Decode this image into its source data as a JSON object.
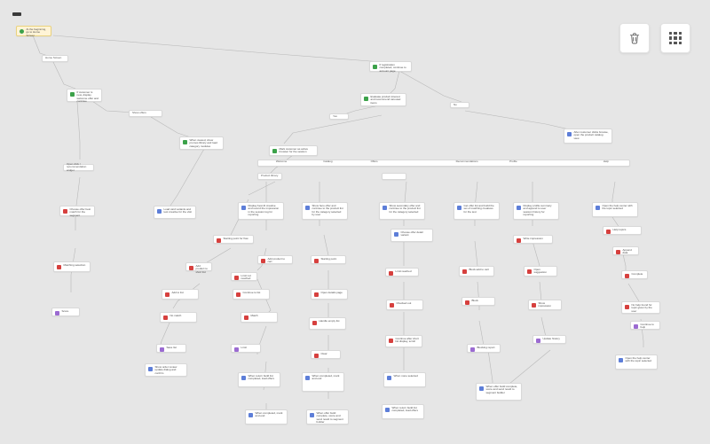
{
  "toolbar": {
    "delete_tooltip": "Delete",
    "grid_tooltip": "Switch layout"
  },
  "nodes": {
    "start": "At the beginning, go to Home Screen",
    "n1": "Home Screen",
    "n2": "If customer is new, display welcome offer and continue",
    "n3": "Show offers",
    "n4": "If registration completed, continue to account page",
    "n5": "Evaluate product interest and recommend carousel items",
    "n6": "Yes",
    "n7": "No",
    "n8": "When viewed, show promos library and load category modules",
    "n9": "After customer clicks browse, open the product catalog view",
    "n10": "Mark customer as active browser for the session",
    "n11": "Open click / recommendation widget",
    "n12": "Product library",
    "n13": "",
    "c0": "Welcome",
    "c1": "Catalog",
    "c2": "Offers",
    "c3": "",
    "c4": "Recommendations",
    "c5": "Profile",
    "c6": "",
    "c7": "Help",
    "n14": "Choose offer best match for the segment",
    "n15": "Load card variants and test creative for the visit",
    "n16": "Display best-fit creative and record the impression in the session log for reporting",
    "n17": "Show hero offer and continue to the product list for the category selected by user",
    "n18": "Show secondary offer and continue to the product list for the category selected",
    "n19": "Get offer list and build the set of matching creatives for the test",
    "n20": "Display profile summary and append to user session history for reporting",
    "n21": "When none selected",
    "n22": "Starting point for flow",
    "n23": "Choose offer detail variant",
    "n24": "Matching selection",
    "n25": "Add product to short list",
    "n26": "Add product to cart",
    "n27": "Starting point",
    "n28": "Limit reached",
    "n29": "Block add to cart",
    "n30": "Limit not reached",
    "n31": "Add to list",
    "n32": "Continue to list",
    "n33": "Open details page",
    "n34": "Checked out",
    "n35": "Block",
    "n36": "Score",
    "n37": "No match",
    "n38": "Match",
    "n39": "Handle empty list",
    "n40": "Save list",
    "n41": "Continue after short list display, scroll",
    "n42": "Blocking report",
    "n43": "Limit",
    "n44": "Clear",
    "n45": "Show order review update dialog and confirm",
    "n46": "When return build list completed, load offers",
    "n47": "When completed, mark and end",
    "n48": "When offer build complete, score and send result to segment builder",
    "n49": "Open the help center with the topic selected",
    "n50": "Write impression",
    "n51": "Open suggestion",
    "n52": "Append data",
    "n53": "Show impression",
    "n54": "Complete",
    "n55": "Update history",
    "n56": "Help topics",
    "n57": "No help found for topic given by the user",
    "n58": "Continue to help"
  }
}
